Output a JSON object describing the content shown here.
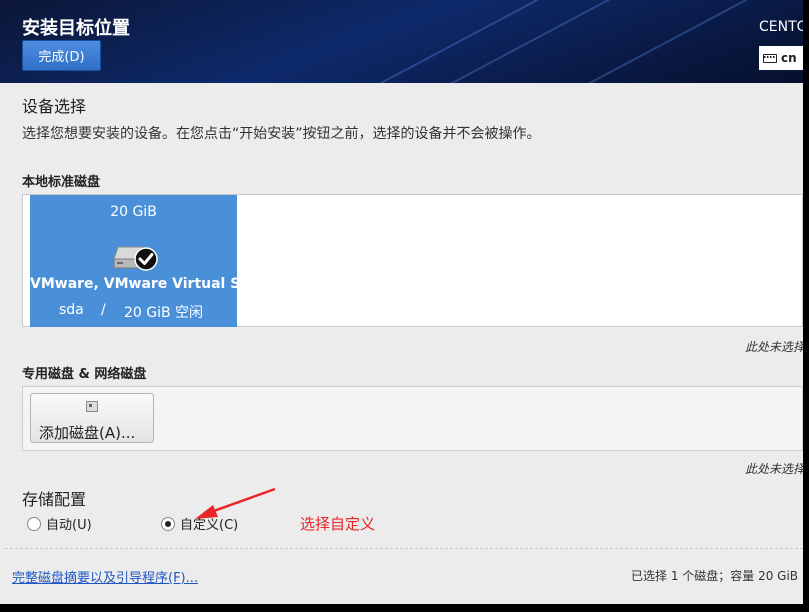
{
  "header": {
    "title": "安装目标位置",
    "done_label": "完成(D)",
    "product": "CENTO",
    "keyboard_layout": "cn"
  },
  "device_selection": {
    "title": "设备选择",
    "description": "选择您想要安装的设备。在您点击“开始安装”按钮之前，选择的设备并不会被操作。"
  },
  "local_disks": {
    "title": "本地标准磁盘",
    "disks": [
      {
        "size": "20 GiB",
        "name": "VMware, VMware Virtual S",
        "device": "sda",
        "separator": "/",
        "free": "20 GiB 空闲",
        "selected": true
      }
    ],
    "note": "此处未选择"
  },
  "specialized_disks": {
    "title": "专用磁盘 & 网络磁盘",
    "add_label": "添加磁盘(A)...",
    "note": "此处未选择"
  },
  "storage_config": {
    "title": "存储配置",
    "options": [
      {
        "label": "自动(U)",
        "selected": false
      },
      {
        "label": "自定义(C)",
        "selected": true
      }
    ],
    "annotation": "选择自定义"
  },
  "footer": {
    "summary_link": "完整磁盘摘要以及引导程序(F)...",
    "status": "已选择 1 个磁盘；容量 20 GiB"
  },
  "colors": {
    "header_bg": "#0e2a6b",
    "accent_blue": "#4a90d9",
    "annotation_red": "#e8262a",
    "link": "#2057c4"
  }
}
